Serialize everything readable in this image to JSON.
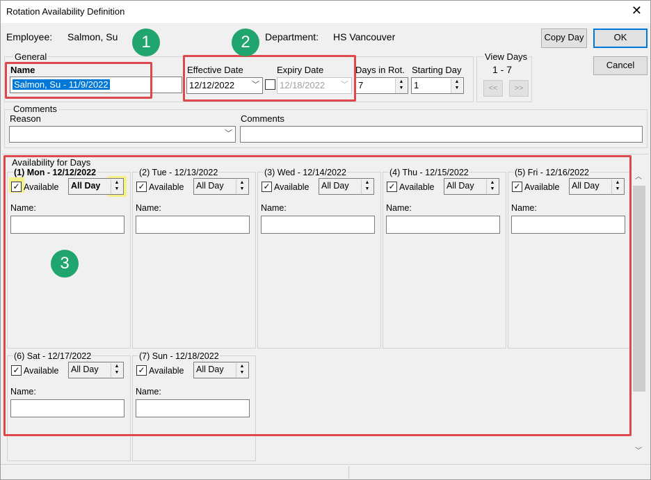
{
  "window": {
    "title": "Rotation Availability Definition",
    "close": "✕"
  },
  "header": {
    "employee_label": "Employee:",
    "employee_value": "Salmon, Su",
    "department_label": "Department:",
    "department_value": "HS Vancouver"
  },
  "buttons": {
    "copy_day": "Copy Day",
    "ok": "OK",
    "cancel": "Cancel",
    "prev": "<<",
    "next": ">>"
  },
  "general": {
    "group_label": "General",
    "name_label": "Name",
    "name_value": "Salmon, Su - 11/9/2022",
    "effective_label": "Effective Date",
    "effective_value": "12/12/2022",
    "expiry_label": "Expiry Date",
    "expiry_value": "12/18/2022",
    "days_rot_label": "Days in Rot.",
    "days_rot_value": "7",
    "starting_label": "Starting Day",
    "starting_value": "1"
  },
  "view_days": {
    "label": "View Days",
    "range": "1 - 7"
  },
  "comments": {
    "group_label": "Comments",
    "reason_label": "Reason",
    "reason_value": "",
    "comments_label": "Comments",
    "comments_value": ""
  },
  "availability": {
    "group_label": "Availability for Days",
    "available_label": "Available",
    "name_label": "Name:",
    "days": [
      {
        "title": "(1) Mon - 12/12/2022",
        "mode": "All Day"
      },
      {
        "title": "(2) Tue - 12/13/2022",
        "mode": "All Day"
      },
      {
        "title": "(3) Wed - 12/14/2022",
        "mode": "All Day"
      },
      {
        "title": "(4) Thu - 12/15/2022",
        "mode": "All Day"
      },
      {
        "title": "(5) Fri - 12/16/2022",
        "mode": "All Day"
      },
      {
        "title": "(6) Sat - 12/17/2022",
        "mode": "All Day"
      },
      {
        "title": "(7) Sun - 12/18/2022",
        "mode": "All Day"
      }
    ]
  },
  "badges": [
    "1",
    "2",
    "3"
  ],
  "colors": {
    "annotation_red": "#e0474c",
    "badge_green": "#20a56e",
    "highlight_yellow": "#f4f18a",
    "selection_blue": "#0078d7"
  }
}
